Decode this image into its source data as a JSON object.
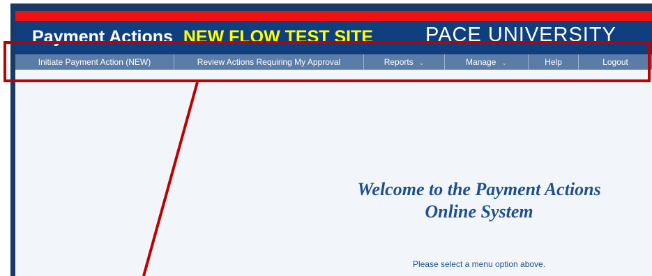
{
  "header": {
    "title": "Payment Actions",
    "test_label": "NEW FLOW TEST SITE",
    "university": "PACE UNIVERSITY"
  },
  "nav": {
    "initiate": "Initiate Payment Action (NEW)",
    "review": "Review Actions Requiring My Approval",
    "reports": "Reports",
    "manage": "Manage",
    "help": "Help",
    "logout": "Logout"
  },
  "main": {
    "welcome_line1": "Welcome to the Payment Actions",
    "welcome_line2": "Online System",
    "instruction": "Please select a menu option above."
  },
  "colors": {
    "accent_red": "#ee1111",
    "header_blue": "#0f3f7e",
    "nav_blue": "#5c7ca8",
    "test_yellow": "#ffff00",
    "highlight_red": "#c00000"
  },
  "icons": {
    "dropdown": "chevron-down-icon"
  }
}
